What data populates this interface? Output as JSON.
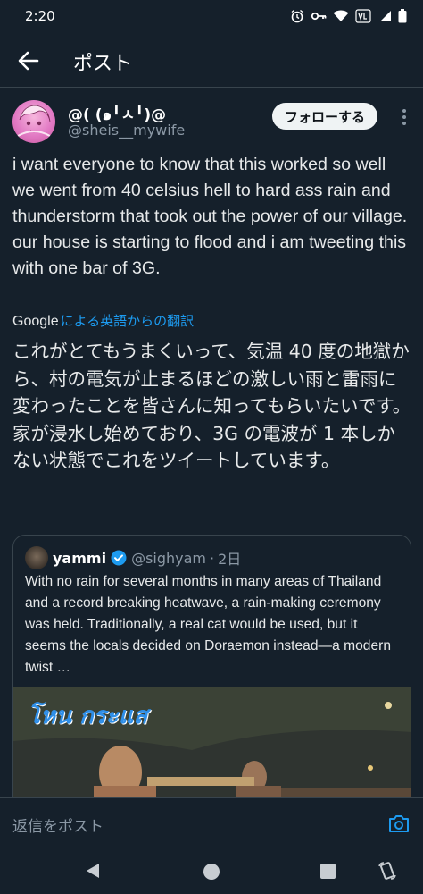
{
  "status_bar": {
    "time": "2:20"
  },
  "header": {
    "title": "ポスト"
  },
  "author": {
    "display_name": "@( (๑╹ㅅ╹)@",
    "handle": "@sheis__mywife",
    "follow_label": "フォローする"
  },
  "tweet": {
    "text": "i want everyone to know that this worked so well we went from 40 celsius hell to hard ass rain and thunderstorm that took out the power of our village. our house is starting to flood and i am tweeting this with one bar of 3G.",
    "translate_provider": "Google",
    "translate_label": "による英語からの翻訳",
    "translated_text": "これがとてもうまくいって、気温 40 度の地獄から、村の電気が止まるほどの激しい雨と雷雨に変わったことを皆さんに知ってもらいたいです。家が浸水し始めており、3G の電波が 1 本しかない状態でこれをツイートしています。"
  },
  "quote": {
    "name": "yammi",
    "handle": "@sighyam",
    "separator": "·",
    "time": "2日",
    "text": "With no rain for several months in many areas of Thailand and a record breaking heatwave, a rain-making ceremony was held. Traditionally, a real cat would be used, but it seems the locals decided on Doraemon instead—a modern twist …",
    "media_logo": "โหน กระแส"
  },
  "reply": {
    "placeholder": "返信をポスト"
  },
  "colors": {
    "background": "#15202b",
    "accent": "#1d9bf0",
    "text": "#e7e9ea",
    "muted": "#8b98a5",
    "border": "#38444d"
  },
  "icons": {
    "back": "arrow-left-icon",
    "more": "more-vertical-icon",
    "verified": "verified-badge-icon",
    "camera": "camera-icon"
  }
}
